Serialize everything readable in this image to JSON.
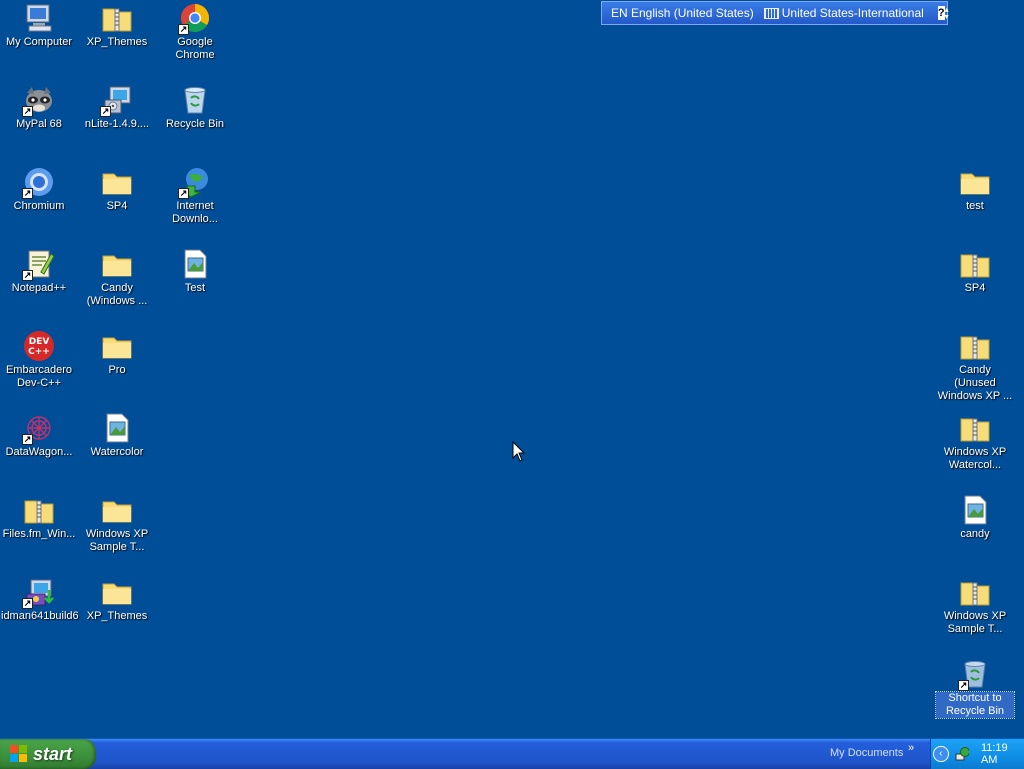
{
  "desktop": {
    "icons": [
      {
        "label": "My Computer"
      },
      {
        "label": "XP_Themes"
      },
      {
        "label": "Google Chrome"
      },
      {
        "label": "MyPal 68"
      },
      {
        "label": "nLite-1.4.9...."
      },
      {
        "label": "Recycle Bin"
      },
      {
        "label": "Chromium"
      },
      {
        "label": "SP4"
      },
      {
        "label": "Internet Downlo..."
      },
      {
        "label": "Notepad++"
      },
      {
        "label": "Candy (Windows ..."
      },
      {
        "label": "Test"
      },
      {
        "label": "Embarcadero Dev-C++"
      },
      {
        "label": "Pro"
      },
      {
        "label": "DataWagon..."
      },
      {
        "label": "Watercolor"
      },
      {
        "label": "Files.fm_Win..."
      },
      {
        "label": "Windows XP Sample T..."
      },
      {
        "label": "idman641build6"
      },
      {
        "label": "XP_Themes"
      },
      {
        "label": "test"
      },
      {
        "label": "SP4"
      },
      {
        "label": "Candy (Unused Windows XP ..."
      },
      {
        "label": "Windows XP Watercol..."
      },
      {
        "label": "candy"
      },
      {
        "label": "Windows XP Sample T..."
      },
      {
        "label": "Shortcut to Recycle Bin"
      }
    ]
  },
  "langbar": {
    "language": "EN English (United States)",
    "keyboard": "United States-International",
    "help": "?"
  },
  "taskbar": {
    "start_label": "start",
    "toolbar_label": "My Documents",
    "toolbar_chevron": "»",
    "tray_chevron": "‹",
    "clock": "11:19 AM"
  }
}
